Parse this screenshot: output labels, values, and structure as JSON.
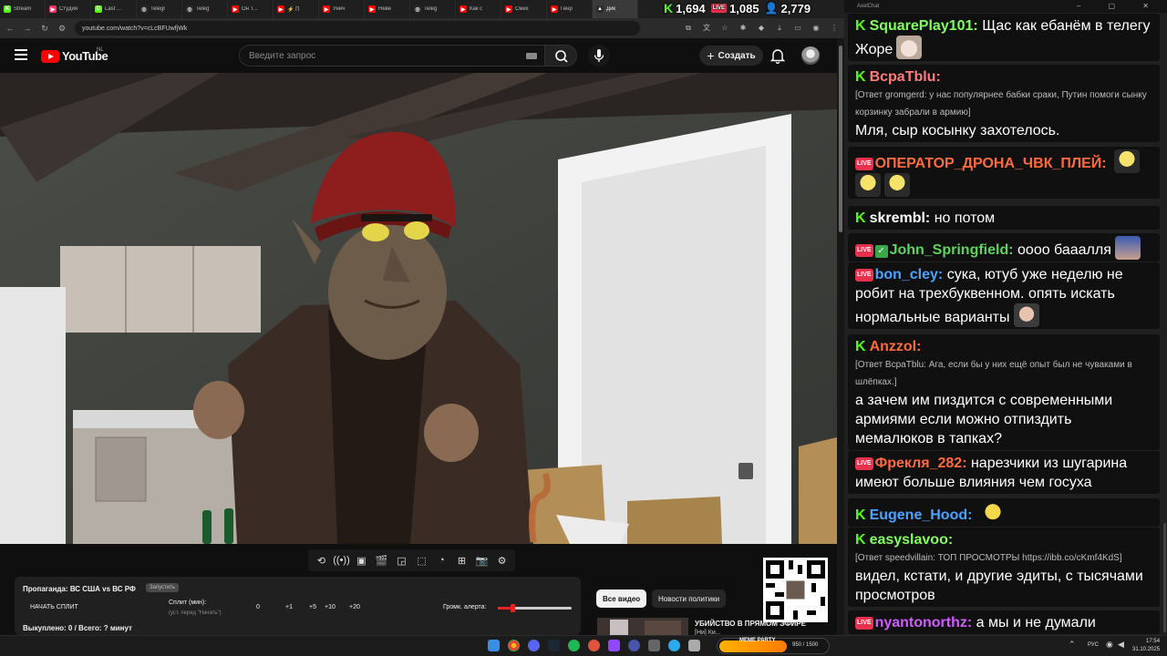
{
  "browser": {
    "tabs": [
      {
        "title": "Stream",
        "color": "#53fc18",
        "glyph": "K"
      },
      {
        "title": "Студия",
        "color": "#ff3366",
        "glyph": "▶"
      },
      {
        "title": "Last ...",
        "color": "#53fc18",
        "glyph": "D"
      },
      {
        "title": "Telegr",
        "color": "#2a2a2a",
        "glyph": "◎"
      },
      {
        "title": "Teleg",
        "color": "#2a2a2a",
        "glyph": "◎"
      },
      {
        "title": "Он Т...",
        "color": "#ff0000",
        "glyph": "▶"
      },
      {
        "title": "⚡ П",
        "color": "#ff0000",
        "glyph": "▶"
      },
      {
        "title": "Унич",
        "color": "#ff0000",
        "glyph": "▶"
      },
      {
        "title": "Неве",
        "color": "#ff0000",
        "glyph": "▶"
      },
      {
        "title": "Teleg",
        "color": "#2a2a2a",
        "glyph": "◎"
      },
      {
        "title": "Как с",
        "color": "#ff0000",
        "glyph": "▶"
      },
      {
        "title": "Смех",
        "color": "#ff0000",
        "glyph": "▶"
      },
      {
        "title": "Генр",
        "color": "#ff0000",
        "glyph": "▶"
      },
      {
        "title": "Дик",
        "color": "#2a2a2a",
        "glyph": "▲"
      }
    ],
    "active_tab": 13,
    "url": "youtube.com/watch?v=cLcBFUwfjWk"
  },
  "stream_stats": {
    "kick_viewers": "1,694",
    "youtube_viewers": "1,085",
    "total_viewers": "2,779",
    "live_badge": "LIVE"
  },
  "youtube": {
    "logo_text": "YouTube",
    "country": "NL",
    "search_placeholder": "Введите запрос",
    "create_label": "Создать"
  },
  "split_panel": {
    "title": "Пропаганда: ВС США vs ВС РФ",
    "badge": "Запустить",
    "start_label": "НАЧАТЬ СПЛИТ",
    "split_label": "Сплит (мин):",
    "split_hint": "(уст. перед \"Начать\")",
    "split_value": "0",
    "increments": [
      "+1",
      "+5",
      "+10",
      "+20"
    ],
    "volume_label": "Громк. алерта:",
    "volume_level": 0.2,
    "bought": "Выкуплено: 0 / Всего: ? минут"
  },
  "chips": {
    "all_videos": "Все видео",
    "politics_news": "Новости политики"
  },
  "related": {
    "title": "УБИЙСТВО В ПРЯМОМ ЭФИРЕ",
    "subtitle": "[Ни] Ки..."
  },
  "chat": {
    "title": "AxelChat",
    "messages": [
      {
        "platform": "kick",
        "nick": "SquarePlay101:",
        "color": "#7fff5a",
        "text": "Щас как ебанём в телегу Жоре"
      },
      {
        "platform": "kick",
        "nick": "BcpaTblu:",
        "color": "#ff7a7a",
        "reply": "[Ответ gromgerd: у нас популярнее бабки сраки, Путин помоги сынку корзинку забрали в армию]",
        "text": "Мля, сыр косынку захотелось."
      },
      {
        "platform": "youtube",
        "nick": "ОПЕРАТОР_ДРОНА_ЧВК_ПЛЕЙ:",
        "color": "#ff6a3d",
        "text": ""
      },
      {
        "platform": "kick",
        "nick": "skrembl:",
        "color": "#ffffff",
        "text": "но потом"
      },
      {
        "platform": "youtube",
        "nick": "John_Springfield:",
        "color": "#5fd35f",
        "text": "оооо бааалля"
      },
      {
        "platform": "youtube",
        "nick": "bon_cley:",
        "color": "#4aa3ff",
        "text": "сука, ютуб уже неделю не робит на трехбуквенном. опять искать нормальные варианты"
      },
      {
        "platform": "kick",
        "nick": "Anzzol:",
        "color": "#ff6a3d",
        "reply": "[Ответ BcpaTblu: Ага, если бы у них ещё опыт был не чуваками в шлёпках.]",
        "text": "а зачем им пиздится с современными армиями если можно отпиздить мемалюков в тапках?"
      },
      {
        "platform": "youtube",
        "nick": "Фрекля_282:",
        "color": "#ff6a3d",
        "text": "нарезчики из шугарина имеют больше влияния чем госуха"
      },
      {
        "platform": "kick",
        "nick": "Eugene_Hood:",
        "color": "#4aa3ff",
        "text": ""
      },
      {
        "platform": "kick",
        "nick": "easyslavoo:",
        "color": "#7fff5a",
        "reply": "[Ответ speedvillain: ТОП ПРОСМОТРЫ https://ibb.co/cKmf4KdS]",
        "text": "видел, кстати, и другие эдиты, с тысячами просмотров"
      },
      {
        "platform": "youtube",
        "nick": "nyantonorthz:",
        "color": "#d05bff",
        "text": "а мы и не думали"
      }
    ]
  },
  "taskbar": {
    "meme_label": "MEME PARTY",
    "meme_count": "950 / 1500",
    "meme_progress": 0.63,
    "lang": "РУС",
    "time": "17:54",
    "date": "31.10.2025"
  }
}
